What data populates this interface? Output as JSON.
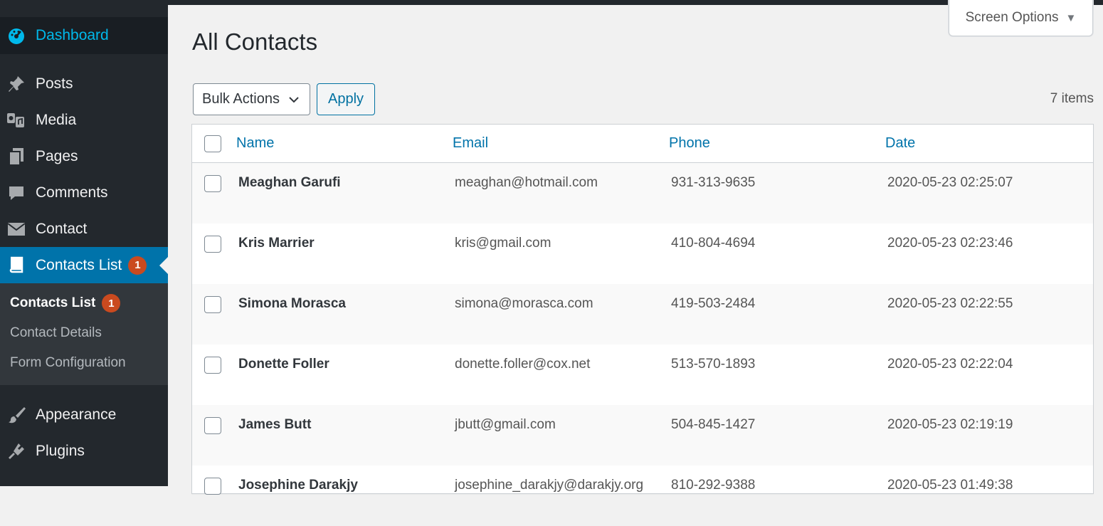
{
  "sidebar": {
    "dashboard": "Dashboard",
    "items": [
      {
        "label": "Posts",
        "icon": "pin-icon"
      },
      {
        "label": "Media",
        "icon": "media-icon"
      },
      {
        "label": "Pages",
        "icon": "pages-icon"
      },
      {
        "label": "Comments",
        "icon": "comment-icon"
      },
      {
        "label": "Contact",
        "icon": "envelope-icon"
      }
    ],
    "active": {
      "label": "Contacts List",
      "badge": "1",
      "icon": "book-icon"
    },
    "submenu": [
      {
        "label": "Contacts List",
        "badge": "1"
      },
      {
        "label": "Contact Details"
      },
      {
        "label": "Form Configuration"
      }
    ],
    "after": [
      {
        "label": "Appearance",
        "icon": "brush-icon"
      },
      {
        "label": "Plugins",
        "icon": "plugin-icon"
      }
    ]
  },
  "header": {
    "screen_options": "Screen Options",
    "title": "All Contacts"
  },
  "toolbar": {
    "bulk_actions": "Bulk Actions",
    "apply": "Apply",
    "items_count": "7 items"
  },
  "table": {
    "columns": [
      "Name",
      "Email",
      "Phone",
      "Date"
    ],
    "rows": [
      {
        "name": "Meaghan Garufi",
        "email": "meaghan@hotmail.com",
        "phone": "931-313-9635",
        "date": "2020-05-23 02:25:07"
      },
      {
        "name": "Kris Marrier",
        "email": "kris@gmail.com",
        "phone": "410-804-4694",
        "date": "2020-05-23 02:23:46"
      },
      {
        "name": "Simona Morasca",
        "email": "simona@morasca.com",
        "phone": "419-503-2484",
        "date": "2020-05-23 02:22:55"
      },
      {
        "name": "Donette Foller",
        "email": "donette.foller@cox.net",
        "phone": "513-570-1893",
        "date": "2020-05-23 02:22:04"
      },
      {
        "name": "James Butt",
        "email": "jbutt@gmail.com",
        "phone": "504-845-1427",
        "date": "2020-05-23 02:19:19"
      },
      {
        "name": "Josephine Darakjy",
        "email": "josephine_darakjy@darakjy.org",
        "phone": "810-292-9388",
        "date": "2020-05-23 01:49:38"
      }
    ]
  },
  "colors": {
    "sidebar_bg": "#23282d",
    "active_bg": "#0073aa",
    "badge": "#ca4a1f",
    "link": "#0073aa"
  }
}
